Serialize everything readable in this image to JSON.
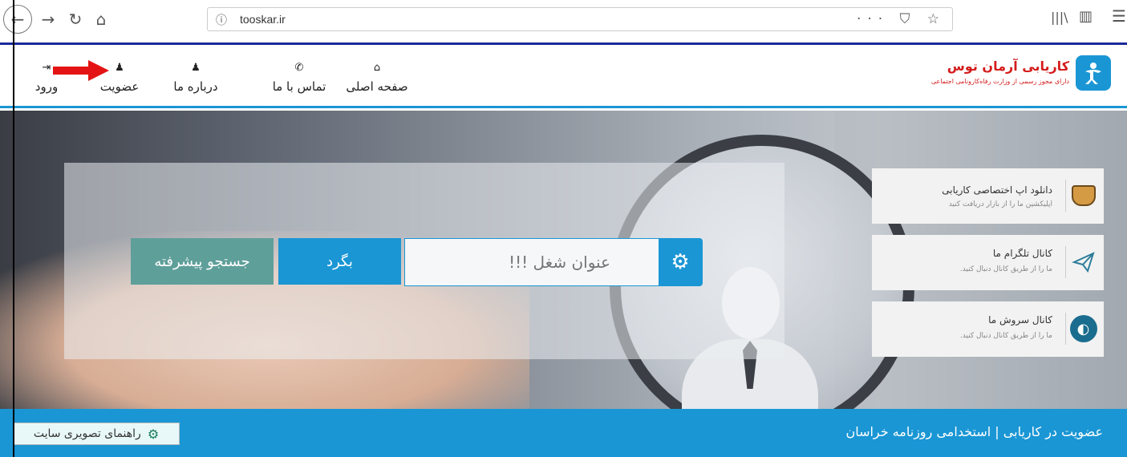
{
  "browser": {
    "back_icon": "arrow-left",
    "forward_icon": "arrow-right",
    "reload_icon": "reload",
    "home_icon": "home",
    "url_info_icon": "ⓘ",
    "url": "tooskar.ir",
    "url_actions": "··· ⛉ ☆",
    "library_icon": "|||\\",
    "sidebar_icon": "▥",
    "menu_icon": "☰"
  },
  "header": {
    "logo_title": "کاریابی آرمان توس",
    "logo_subtitle": "دارای مجوز رسمی از وزارت رفاه‌کارونامی اجتماعی",
    "nav": [
      {
        "label": "صفحه اصلی",
        "icon": "home-icon"
      },
      {
        "label": "تماس با ما",
        "icon": "phone-icon"
      },
      {
        "label": "درباره ما",
        "icon": "user-icon"
      },
      {
        "label": "عضویت",
        "icon": "user-icon"
      },
      {
        "label": "ورود",
        "icon": "login-icon"
      }
    ]
  },
  "search": {
    "placeholder": "عنوان شغل !!!",
    "go_label": "بگرد",
    "advanced_label": "جستجو پیشرفته"
  },
  "side_cards": [
    {
      "title": "دانلود اپ اختصاصی کاریابی",
      "subtitle": "اپلیکشین ما را از بازار دریافت کنید",
      "icon": "bag-icon"
    },
    {
      "title": "کانال تلگرام ما",
      "subtitle": "ما را از طریق کانال دنبال کنید.",
      "icon": "telegram-icon"
    },
    {
      "title": "کانال سروش ما",
      "subtitle": "ما را از طریق کانال دنبال کنید.",
      "icon": "soroush-icon"
    }
  ],
  "footer": {
    "title": "عضویت در کاریابی | استخدامی روزنامه خراسان",
    "guide_label": "راهنمای تصویری سایت"
  },
  "colors": {
    "accent": "#1a96d4",
    "advanced_button": "#5f9f9a",
    "brand_red": "#d41c1c",
    "annotation_arrow": "#e41414"
  }
}
